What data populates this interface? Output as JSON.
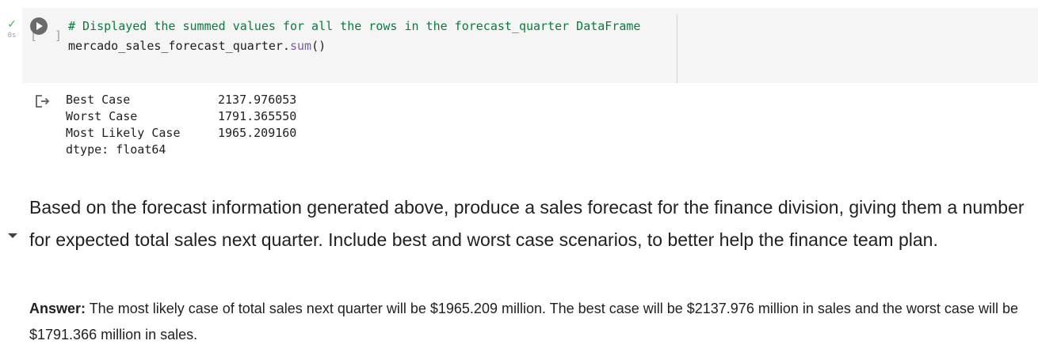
{
  "code_cell": {
    "status": {
      "icon": "check-icon",
      "exec_time": "0s"
    },
    "run_button": {
      "bracket_left": "[",
      "bracket_right": "]",
      "icon": "play-icon"
    },
    "lines": {
      "comment": "# Displayed the summed values for all the rows in the forecast_quarter DataFrame",
      "code_prefix": "mercado_sales_forecast_quarter.",
      "code_method": "sum",
      "code_suffix": "()"
    }
  },
  "output": {
    "icon": "output-arrow-icon",
    "rows": [
      {
        "label": "Best Case",
        "value": "2137.976053"
      },
      {
        "label": "Worst Case",
        "value": "1791.365550"
      },
      {
        "label": "Most Likely Case",
        "value": "1965.209160"
      }
    ],
    "dtype": "dtype: float64"
  },
  "text_cell": {
    "question": "Based on the forecast information generated above, produce a sales forecast for the finance division, giving them a number for expected total sales next quarter. Include best and worst case scenarios, to better help the finance team plan.",
    "answer_label": "Answer:",
    "answer_text": " The most likely case of total sales next quarter will be $1965.209 million. The best case will be $2137.976 million in sales and the worst case will be $1791.366 million in sales."
  },
  "colors": {
    "check": "#4caf50",
    "comment": "#0b7b3e",
    "method": "#795da3",
    "cell_background": "#f5f5f5"
  }
}
